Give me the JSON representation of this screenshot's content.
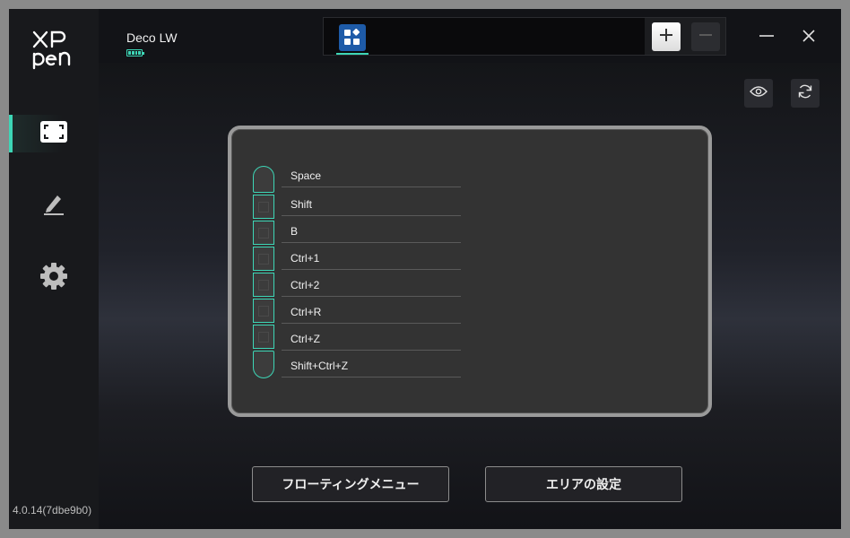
{
  "sidebar": {
    "logo_text": "XP-Pen",
    "nav": [
      {
        "id": "tablet-area",
        "icon": "screen-area-icon",
        "active": true
      },
      {
        "id": "pen",
        "icon": "pen-icon",
        "active": false
      },
      {
        "id": "settings",
        "icon": "gear-icon",
        "active": false
      }
    ],
    "version": "4.0.14(7dbe9b0)"
  },
  "header": {
    "device_name": "Deco LW",
    "battery_status": "charging",
    "app_tab_icon": "app-grid-icon",
    "add_icon": "plus-icon",
    "remove_icon": "minus-icon"
  },
  "colors": {
    "accent": "#3dd6b6",
    "app_icon_bg": "#1e5ba8",
    "background": "#121317"
  },
  "toolbar": {
    "preview_icon": "eye-icon",
    "reset_icon": "refresh-icon"
  },
  "express_keys": [
    {
      "label": "Space"
    },
    {
      "label": "Shift"
    },
    {
      "label": "B"
    },
    {
      "label": "Ctrl+1"
    },
    {
      "label": "Ctrl+2"
    },
    {
      "label": "Ctrl+R"
    },
    {
      "label": "Ctrl+Z"
    },
    {
      "label": "Shift+Ctrl+Z"
    }
  ],
  "buttons": {
    "floating_menu": "フローティングメニュー",
    "area_settings": "エリアの設定"
  }
}
